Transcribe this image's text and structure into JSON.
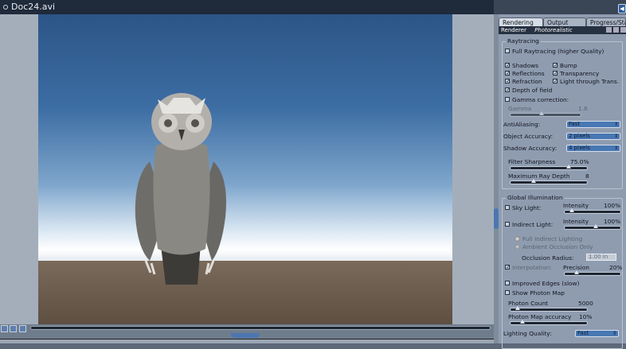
{
  "window": {
    "title": "Doc24.avi"
  },
  "panel": {
    "tabs": [
      "Rendering",
      "Output",
      "Progress/Statis"
    ],
    "renderer_label": "Renderer",
    "renderer_value": "Photorealistic",
    "raytracing": {
      "title": "Raytracing",
      "full_raytracing": {
        "label": "Full Raytracing (higher Quality)",
        "checked": false
      },
      "options": [
        {
          "label": "Shadows",
          "checked": true
        },
        {
          "label": "Bump",
          "checked": true
        },
        {
          "label": "Reflections",
          "checked": true
        },
        {
          "label": "Transparency",
          "checked": true
        },
        {
          "label": "Refraction",
          "checked": true
        },
        {
          "label": "Light through Trans.",
          "checked": true
        }
      ],
      "depth_of_field": {
        "label": "Depth of field",
        "checked": true
      },
      "gamma_correction": {
        "label": "Gamma correction:",
        "checked": false
      },
      "gamma": {
        "label": "Gamma",
        "value": "1.8",
        "fraction": 0.4
      },
      "antialiasing": {
        "label": "AntiAliasing:",
        "value": "Fast"
      },
      "object_accuracy": {
        "label": "Object Accuracy:",
        "value": "2 pixels"
      },
      "shadow_accuracy": {
        "label": "Shadow Accuracy:",
        "value": "4 pixels"
      },
      "filter_sharpness": {
        "label": "Filter Sharpness",
        "value": "75.0%",
        "fraction": 0.75
      },
      "max_ray_depth": {
        "label": "Maximum Ray Depth",
        "value": "8",
        "fraction": 0.3
      }
    },
    "gi": {
      "title": "Global Illumination",
      "sky_light": {
        "label": "Sky Light:",
        "checked": false,
        "intensity_label": "Intensity",
        "intensity": "100%",
        "fraction": 0.1
      },
      "indirect_light": {
        "label": "Indirect Light:",
        "checked": false,
        "intensity_label": "Intensity",
        "intensity": "100%",
        "fraction": 0.55
      },
      "full_indirect": "Full Indirect Lighting",
      "ambient_occlusion": "Ambient Occlusion Only",
      "occlusion_radius": {
        "label": "Occlusion Radius:",
        "value": "1.00 in"
      },
      "interpolation": {
        "label": "Interpolation:",
        "checked": true,
        "precision_label": "Precision",
        "precision": "20%",
        "fraction": 0.2
      },
      "improved_edges": {
        "label": "Improved Edges (slow)",
        "checked": false
      },
      "show_photon_map": {
        "label": "Show Photon Map",
        "checked": false
      },
      "photon_count": {
        "label": "Photon Count",
        "value": "5000",
        "fraction": 0.1
      },
      "photon_map_accuracy": {
        "label": "Photon Map accuracy",
        "value": "10%",
        "fraction": 0.15
      },
      "lighting_quality": {
        "label": "Lighting Quality:",
        "value": "Fast"
      }
    }
  }
}
